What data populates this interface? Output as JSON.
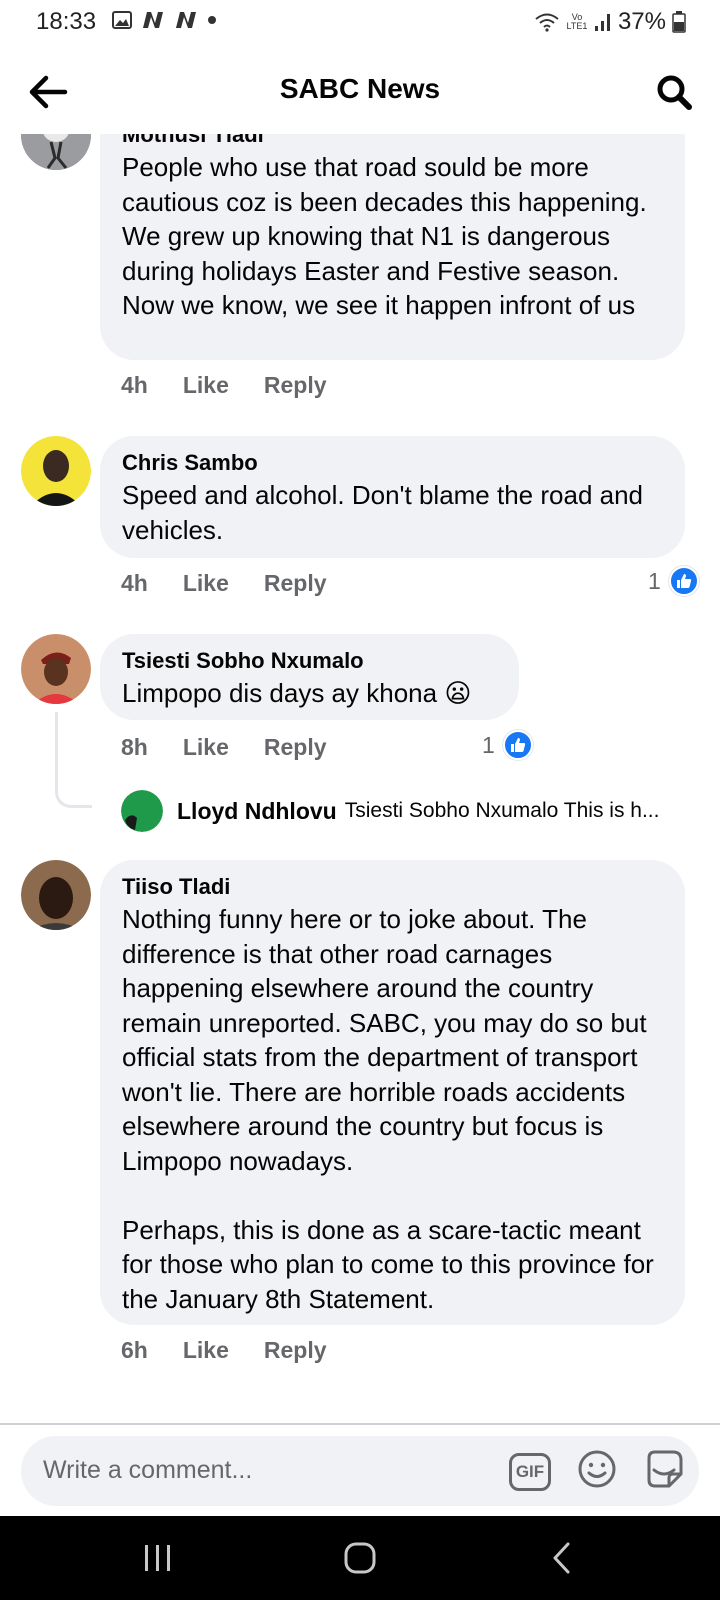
{
  "status_bar": {
    "time": "18:33",
    "network_label": "Vo LTE1",
    "battery": "37%"
  },
  "app_bar": {
    "title": "SABC News",
    "back_icon": "arrow-left-icon",
    "search_icon": "search-icon"
  },
  "comments": [
    {
      "author": "Mothusi Tladi",
      "text": "People who use that road sould be more cautious coz is been decades this happening. We grew up knowing that N1 is dangerous during holidays Easter and Festive season. Now we know, we see it happen infront of us",
      "time": "4h",
      "like_label": "Like",
      "reply_label": "Reply"
    },
    {
      "author": "Chris Sambo",
      "text": "Speed and alcohol. Don't blame the road and vehicles.",
      "time": "4h",
      "like_label": "Like",
      "reply_label": "Reply",
      "reactions": "1"
    },
    {
      "author": "Tsiesti Sobho Nxumalo",
      "text": "Limpopo dis days ay khona",
      "emoji": "😦",
      "time": "8h",
      "like_label": "Like",
      "reply_label": "Reply",
      "reactions": "1",
      "reply_preview": {
        "author": "Lloyd Ndhlovu",
        "snippet": "Tsiesti Sobho Nxumalo This is h..."
      }
    },
    {
      "author": "Tiiso Tladi",
      "text": "Nothing funny here or to joke about. The difference is that other road carnages happening elsewhere around the country remain unreported. SABC, you may do so but official stats from the department of transport won't lie. There are horrible roads accidents elsewhere around the country but focus is Limpopo nowadays.\n\nPerhaps, this is done as a scare-tactic meant for those who plan to come to this province for the January 8th Statement.",
      "time": "6h",
      "like_label": "Like",
      "reply_label": "Reply"
    }
  ],
  "composer": {
    "placeholder": "Write a comment...",
    "gif_label": "GIF"
  },
  "nav": {
    "recents_icon": "recents-icon",
    "home_icon": "home-icon",
    "back_icon": "nav-back-icon"
  },
  "colors": {
    "bubble": "#f0f2f5",
    "meta": "#65676b",
    "like_blue": "#1877f2"
  }
}
